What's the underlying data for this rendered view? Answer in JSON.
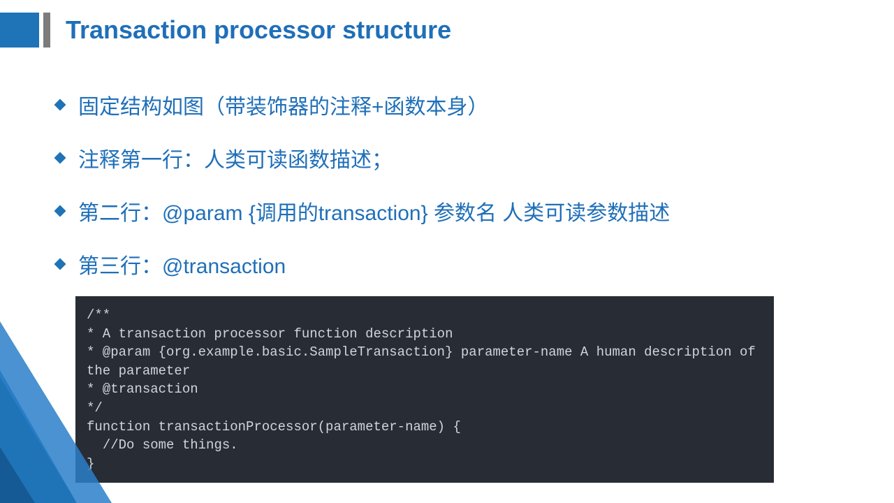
{
  "title": "Transaction processor structure",
  "bullets": [
    "固定结构如图（带装饰器的注释+函数本身）",
    "注释第一行：人类可读函数描述；",
    "第二行：@param {调用的transaction}  参数名 人类可读参数描述",
    "第三行：@transaction"
  ],
  "code": "/**\n* A transaction processor function description\n* @param {org.example.basic.SampleTransaction} parameter-name A human description of the parameter\n* @transaction\n*/\nfunction transactionProcessor(parameter-name) {\n  //Do some things.\n}"
}
